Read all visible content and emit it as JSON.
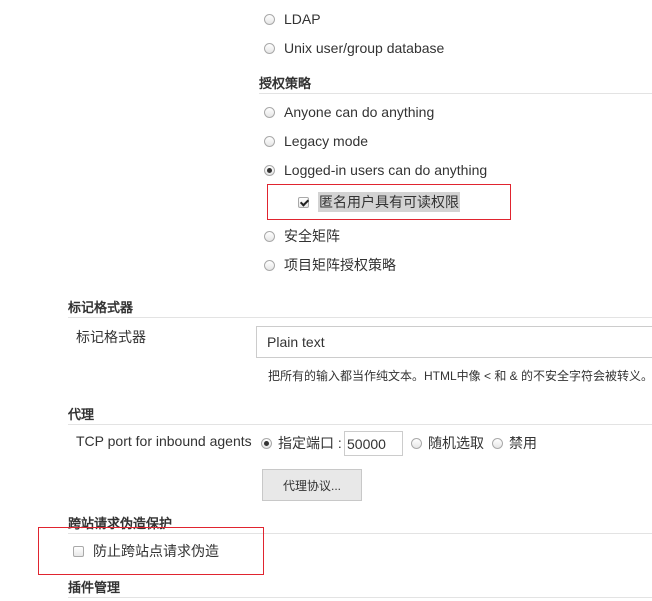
{
  "security_realm": {
    "options": [
      {
        "label": "LDAP",
        "selected": false
      },
      {
        "label": "Unix user/group database",
        "selected": false
      }
    ]
  },
  "authorization": {
    "heading": "授权策略",
    "options": [
      {
        "label": "Anyone can do anything",
        "selected": false
      },
      {
        "label": "Legacy mode",
        "selected": false
      },
      {
        "label": "Logged-in users can do anything",
        "selected": true
      },
      {
        "label": "安全矩阵",
        "selected": false
      },
      {
        "label": "项目矩阵授权策略",
        "selected": false
      }
    ],
    "anonymous_read": {
      "label": "匿名用户具有可读权限",
      "checked": true
    }
  },
  "markup_formatter": {
    "heading": "标记格式器",
    "field_label": "标记格式器",
    "selected_value": "Plain text",
    "help_text": "把所有的输入都当作纯文本。HTML中像 < 和 & 的不安全字符会被转义。"
  },
  "proxy": {
    "heading": "代理",
    "field_label": "TCP port for inbound agents",
    "options": [
      {
        "label": "指定端口 :",
        "selected": true
      },
      {
        "label": "随机选取",
        "selected": false
      },
      {
        "label": "禁用",
        "selected": false
      }
    ],
    "port_value": "50000",
    "protocols_button": "代理协议..."
  },
  "csrf": {
    "heading": "跨站请求伪造保护",
    "checkbox": {
      "label": "防止跨站点请求伪造",
      "checked": false
    }
  },
  "plugin_manager": {
    "heading": "插件管理"
  },
  "colors": {
    "highlight_border": "#e0242f",
    "selection_bg": "#d3d3d3"
  }
}
